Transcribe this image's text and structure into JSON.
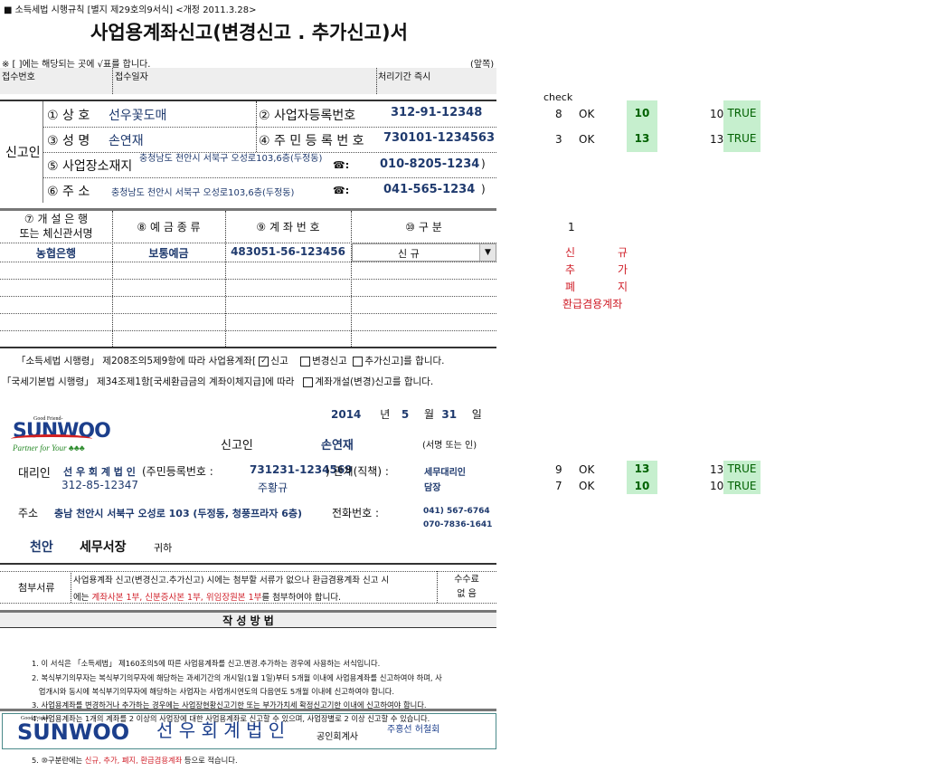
{
  "header": {
    "form_ref": "■  소득세법 시행규칙 [별지 제29호의9서식] <개정 2011.3.28>",
    "title": "사업용계좌신고(변경신고 . 추가신고)서",
    "note": "※ [   ]에는 해당되는 곳에 √표를 합니다.",
    "side": "(앞쪽)"
  },
  "receipt": {
    "no_label": "접수번호",
    "date_label": "접수일자",
    "period_label": "처리기간 즉시"
  },
  "reporter": {
    "section_label": "신고인",
    "name_label": "① 상      호",
    "name": "선우꽃도매",
    "bizno_label": "② 사업자등록번호",
    "bizno": "312-91-12348",
    "person_label": "③ 성      명",
    "person": "손연재",
    "rrn_label": "④ 주 민 등 록 번 호",
    "rrn": "730101-1234563",
    "biz_addr_label": "⑤ 사업장소재지",
    "biz_addr": "충청남도 천안시 서북구 오성로103,6층(두정동)",
    "phone_icon": "☎:",
    "biz_phone": "010-8205-1234",
    "addr_label": "⑥ 주      소",
    "addr": "충청남도 천안시 서북구 오성로103,6층(두정동)",
    "phone": "041-565-1234",
    "paren": ")"
  },
  "accounts": {
    "headers": [
      "⑦ 개 설 은 행",
      "또는 체신관서명",
      "⑧ 예 금 종 류",
      "⑨ 계 좌 번 호",
      "⑩ 구      분"
    ],
    "row": {
      "bank": "농협은행",
      "type": "보통예금",
      "number": "483051-56-123456",
      "category": "신         규"
    }
  },
  "statements": {
    "s1_pre": "「소득세법 시행령」 제208조의5제9항에 따라 사업용계좌[",
    "opt1": "신고",
    "opt2": "변경신고",
    "opt3": "추가신고]를 합니다.",
    "s2_pre": "「국세기본법 시행령」 제34조제1항[국세환급금의 계좌이체지급]에 따라",
    "opt4": "계좌개설(변경)신고를 합니다.",
    "check": "✓"
  },
  "date": {
    "year": "2014",
    "y": "년",
    "month": "5",
    "m": "월",
    "day": "31",
    "d": "일"
  },
  "logo": {
    "top": "Good Friend-",
    "brand": "SUNWOO",
    "slogan": "Partner for Your ♣♣♣"
  },
  "signer": {
    "label": "신고인",
    "name": "손연재",
    "sign": "(서명 또는 인)"
  },
  "agent": {
    "label": "대리인",
    "firm": "선 우 회 계 법 인",
    "rrn_label": "(주민등록번호 :",
    "rrn": "731231-1234569",
    "rel_label": ") 관계(직책) :",
    "rel": "세무대리인",
    "bizno": "312-85-12347",
    "person": "주황규",
    "role": "담장",
    "addr_label": "주소",
    "addr": "충남 천안시 서북구 오성로 103 (두정동, 청풍프라자 6층)",
    "tel_label": "전화번호 :",
    "tel1": "041) 567-6764",
    "tel2": "070-7836-1641"
  },
  "office": {
    "city": "천안",
    "name": "세무서장",
    "suffix": "귀하"
  },
  "attach": {
    "label": "첨부서류",
    "line1": "사업용계좌 신고(변경신고.추가신고) 시에는 첨부할 서류가 없으나 환급겸용계좌 신고 시",
    "l2a": "에는 ",
    "l2red": "계좌사본 1부, 신분증사본 1부, 위임장원본 1부",
    "l2b": "를 첨부하여야 합니다.",
    "fee1": "수수료",
    "fee2": "없 음"
  },
  "instructions": {
    "title": "작 성 방 법",
    "items": [
      "1. 이 서식은 「소득세법」 제160조의5에 따른 사업용계좌를 신고.변경.추가하는 경우에 사용하는 서식입니다.",
      "2. 복식부기의무자는 복식부기의무자에 해당하는 과세기간의 개시일(1월 1일)부터 5개월 이내에 사업용계좌를 신고하여야 하며, 사",
      "   업개시와 동시에 복식부기의무자에 해당하는 사업자는 사업개시연도의 다음연도 5개월 이내에 신고하여야 합니다.",
      "3. 사업용계좌를 변경하거나 추가하는 경우에는 사업장현황신고기한 또는 부가가치세 확정신고기한 이내에 신고하여야 합니다.",
      "4. 사업용계좌는 1개의 계좌를 2 이상의 사업장에 대한 사업용계좌로 신고할 수 있으며, 사업장별로 2 이상 신고할 수 있습니다."
    ],
    "item5_pre": "5. ⑩구분란에는 ",
    "item5_red": "신규, 추가, 폐지, 환급겸용계좌",
    "item5_post": " 등으로 적습니다."
  },
  "footer": {
    "firm": "선 우 회 계 법 인",
    "title": "공인회계사",
    "names": "주홍선  허철회"
  },
  "sidecheck": {
    "label": "check",
    "rows": [
      [
        "8",
        "OK",
        "10",
        "10",
        "TRUE"
      ],
      [
        "3",
        "OK",
        "13",
        "13",
        "TRUE"
      ],
      [
        "9",
        "OK",
        "13",
        "13",
        "TRUE"
      ],
      [
        "7",
        "OK",
        "10",
        "10",
        "TRUE"
      ]
    ],
    "one": "1",
    "options": [
      [
        "신",
        "규"
      ],
      [
        "추",
        "가"
      ],
      [
        "폐",
        "지"
      ]
    ],
    "last": "환급겸용계좌"
  }
}
